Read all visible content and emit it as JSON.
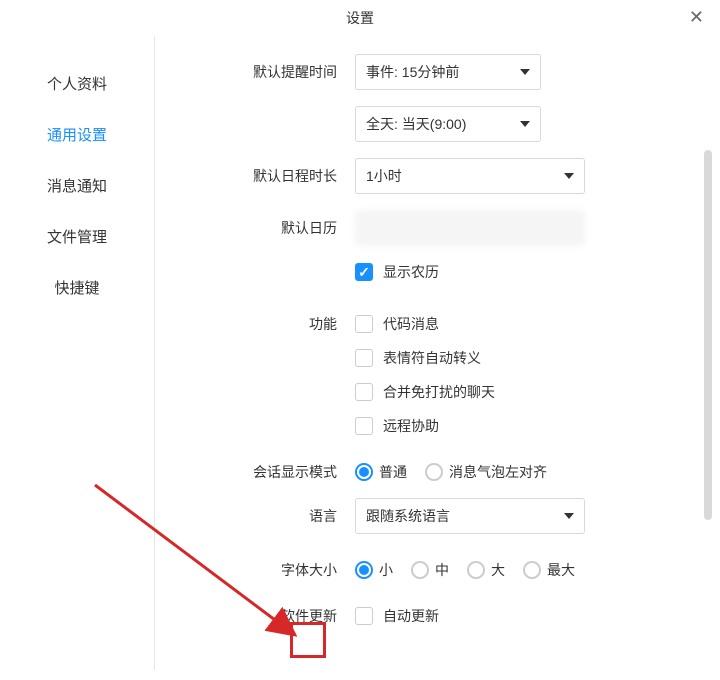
{
  "title": "设置",
  "sidebar": {
    "items": [
      {
        "label": "个人资料"
      },
      {
        "label": "通用设置"
      },
      {
        "label": "消息通知"
      },
      {
        "label": "文件管理"
      },
      {
        "label": "快捷键"
      }
    ]
  },
  "reminder": {
    "label": "默认提醒时间",
    "event_value": "事件: 15分钟前",
    "allday_value": "全天: 当天(9:00)"
  },
  "duration": {
    "label": "默认日程时长",
    "value": "1小时"
  },
  "default_calendar": {
    "label": "默认日历"
  },
  "lunar": {
    "label": "显示农历"
  },
  "function": {
    "label": "功能",
    "items": [
      {
        "label": "代码消息"
      },
      {
        "label": "表情符自动转义"
      },
      {
        "label": "合并免打扰的聊天"
      },
      {
        "label": "远程协助"
      }
    ]
  },
  "conversation": {
    "label": "会话显示模式",
    "options": [
      {
        "label": "普通"
      },
      {
        "label": "消息气泡左对齐"
      }
    ]
  },
  "language": {
    "label": "语言",
    "value": "跟随系统语言"
  },
  "font": {
    "label": "字体大小",
    "options": [
      {
        "label": "小"
      },
      {
        "label": "中"
      },
      {
        "label": "大"
      },
      {
        "label": "最大"
      }
    ]
  },
  "update": {
    "label": "软件更新",
    "option": "自动更新"
  }
}
